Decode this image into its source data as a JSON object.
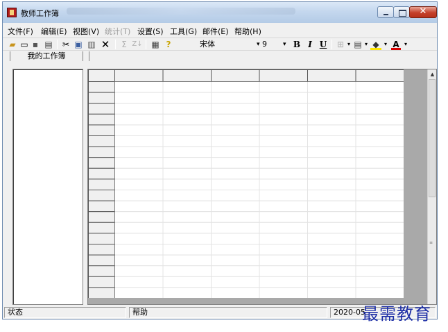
{
  "window": {
    "title": "教师工作簿"
  },
  "menu": [
    {
      "label": "文件(F)",
      "enabled": true
    },
    {
      "label": "编辑(E)",
      "enabled": true
    },
    {
      "label": "视图(V)",
      "enabled": true
    },
    {
      "label": "统计(T)",
      "enabled": false
    },
    {
      "label": "设置(S)",
      "enabled": true
    },
    {
      "label": "工具(G)",
      "enabled": true
    },
    {
      "label": "邮件(E)",
      "enabled": true
    },
    {
      "label": "帮助(H)",
      "enabled": true
    }
  ],
  "toolbar": {
    "font_name": "宋体",
    "font_size": "9",
    "bold_label": "B",
    "italic_label": "I",
    "underline_label": "U",
    "sum_label": "Σ",
    "sort_label": "Z↓",
    "delete_label": "✕",
    "help_label": "?",
    "dropdown_arrow": "▾",
    "fill_label": "◆",
    "font_color_label": "A",
    "icons": [
      "open-folder-icon",
      "new-file-icon",
      "save-icon",
      "print-icon",
      "cut-icon",
      "copy-icon",
      "paste-icon",
      "delete-icon",
      "sum-icon",
      "sort-icon",
      "properties-icon",
      "help-icon",
      "border-icon",
      "format-icon",
      "fill-color-icon",
      "font-color-icon"
    ]
  },
  "left_pane": {
    "title": "我的工作簿"
  },
  "grid": {
    "columns": 6,
    "rows": 20
  },
  "statusbar": {
    "status": "状态",
    "help": "帮助",
    "date": "2020-05-"
  },
  "watermark": "最需教育",
  "colors": {
    "title_bar": "#c4d7ee",
    "close_button": "#c4412b",
    "window_bg": "#f0f0f0",
    "grid_dark": "#a9a9a9",
    "watermark": "#1e2fa6"
  }
}
